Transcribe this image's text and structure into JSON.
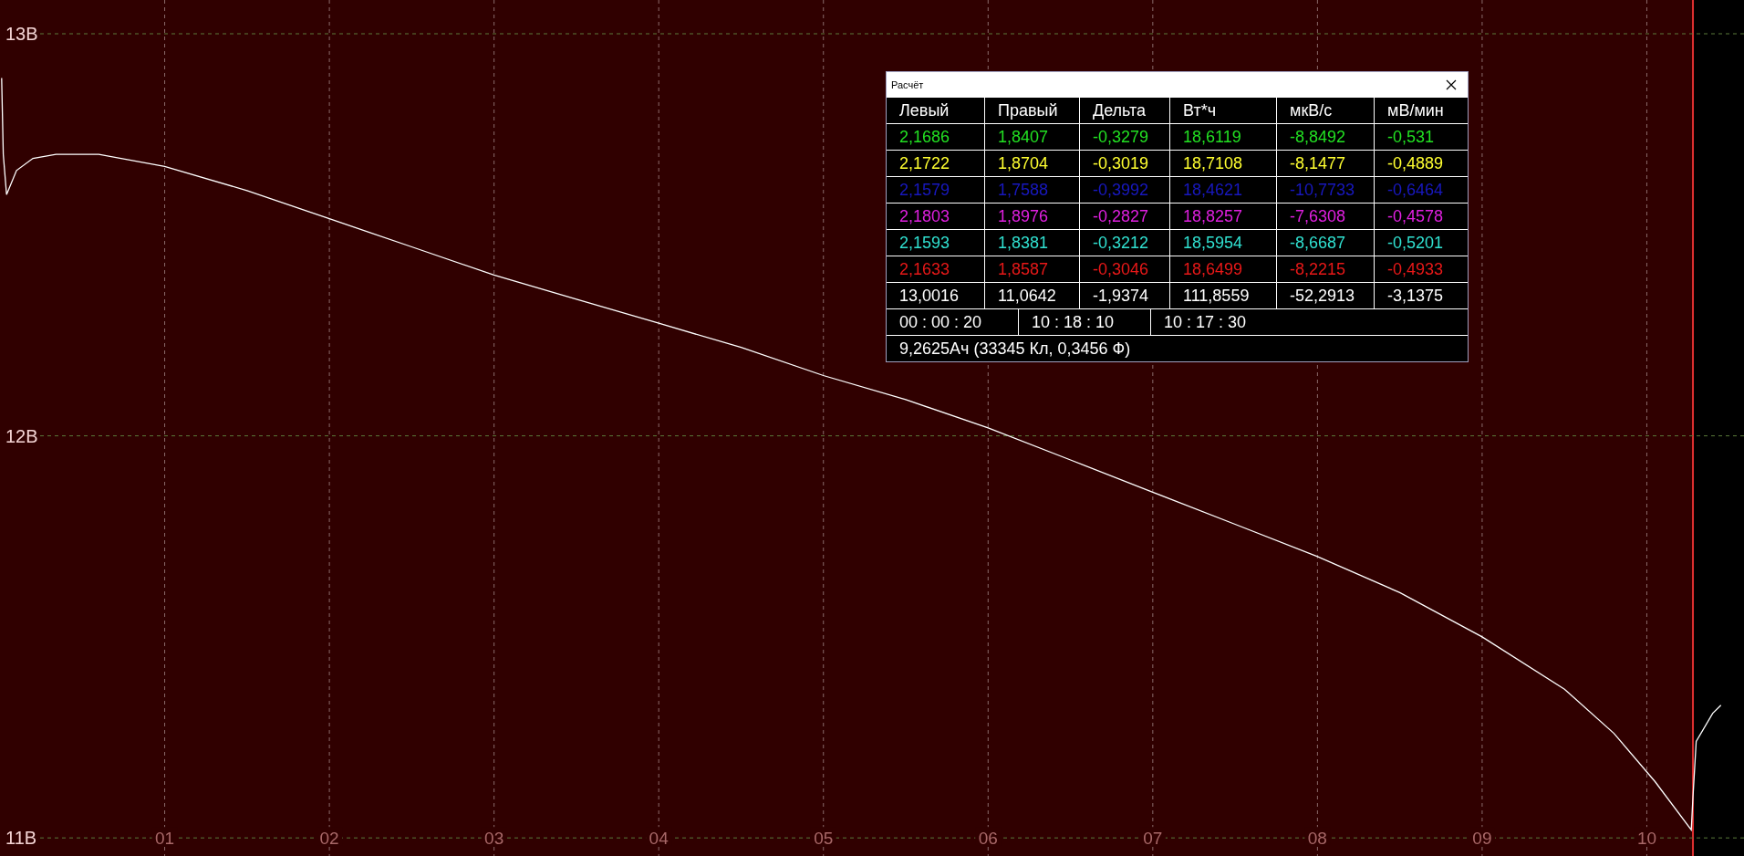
{
  "chart": {
    "chart_data": {
      "type": "line",
      "xlim": [
        0,
        10.59
      ],
      "ylim": [
        10.955,
        13.084
      ],
      "xticks": [
        {
          "value": 1,
          "label": "01"
        },
        {
          "value": 2,
          "label": "02"
        },
        {
          "value": 3,
          "label": "03"
        },
        {
          "value": 4,
          "label": "04"
        },
        {
          "value": 5,
          "label": "05"
        },
        {
          "value": 6,
          "label": "06"
        },
        {
          "value": 7,
          "label": "07"
        },
        {
          "value": 8,
          "label": "08"
        },
        {
          "value": 9,
          "label": "09"
        },
        {
          "value": 10,
          "label": "10"
        }
      ],
      "yticks": [
        {
          "value": 13,
          "label": "13В"
        },
        {
          "value": 12,
          "label": "12В"
        },
        {
          "value": 11,
          "label": "11В"
        }
      ],
      "x": [
        0.01,
        0.02,
        0.04,
        0.1,
        0.2,
        0.34,
        0.6,
        1,
        1.5,
        2,
        2.5,
        3,
        3.5,
        4,
        4.5,
        5,
        5.5,
        6,
        6.5,
        7,
        7.5,
        8,
        8.5,
        9,
        9.5,
        9.8,
        10.05,
        10.27,
        10.28,
        10.3,
        10.4,
        10.45
      ],
      "series": [
        {
          "color": "#ffffff",
          "values": [
            12.89,
            12.7,
            12.6,
            12.66,
            12.69,
            12.7,
            12.7,
            12.67,
            12.61,
            12.54,
            12.47,
            12.4,
            12.34,
            12.28,
            12.22,
            12.15,
            12.09,
            12.02,
            11.94,
            11.86,
            11.78,
            11.7,
            11.61,
            11.5,
            11.37,
            11.26,
            11.14,
            11.02,
            11.1,
            11.24,
            11.31,
            11.33
          ]
        }
      ],
      "grid": true,
      "bands": [
        {
          "axis": "x",
          "from": 0,
          "to": 10.28,
          "color": "#300000"
        }
      ],
      "ref_lines": [
        {
          "axis": "x",
          "value": 10.28,
          "color": "#e03030"
        }
      ]
    }
  },
  "calc_window": {
    "title": "Расчёт",
    "columns": [
      "Левый",
      "Правый",
      "Дельта",
      "Вт*ч",
      "мкВ/с",
      "мВ/мин"
    ],
    "rows": [
      {
        "color": "#22e022",
        "cells": [
          "2,1686",
          "1,8407",
          "-0,3279",
          "18,6119",
          "-8,8492",
          "-0,531"
        ]
      },
      {
        "color": "#ffff30",
        "cells": [
          "2,1722",
          "1,8704",
          "-0,3019",
          "18,7108",
          "-8,1477",
          "-0,4889"
        ]
      },
      {
        "color": "#1818c0",
        "cells": [
          "2,1579",
          "1,7588",
          "-0,3992",
          "18,4621",
          "-10,7733",
          "-0,6464"
        ]
      },
      {
        "color": "#e020e0",
        "cells": [
          "2,1803",
          "1,8976",
          "-0,2827",
          "18,8257",
          "-7,6308",
          "-0,4578"
        ]
      },
      {
        "color": "#30e0d0",
        "cells": [
          "2,1593",
          "1,8381",
          "-0,3212",
          "18,5954",
          "-8,6687",
          "-0,5201"
        ]
      },
      {
        "color": "#e81818",
        "cells": [
          "2,1633",
          "1,8587",
          "-0,3046",
          "18,6499",
          "-8,2215",
          "-0,4933"
        ]
      },
      {
        "color": "#ffffff",
        "cells": [
          "13,0016",
          "11,0642",
          "-1,9374",
          "111,8559",
          "-52,2913",
          "-3,1375"
        ]
      }
    ],
    "times": [
      "00 : 00 : 20",
      "10 : 18 : 10",
      "10 : 17 : 30"
    ],
    "summary": "9,2625Ач (33345 Кл, 0,3456 Ф)"
  }
}
